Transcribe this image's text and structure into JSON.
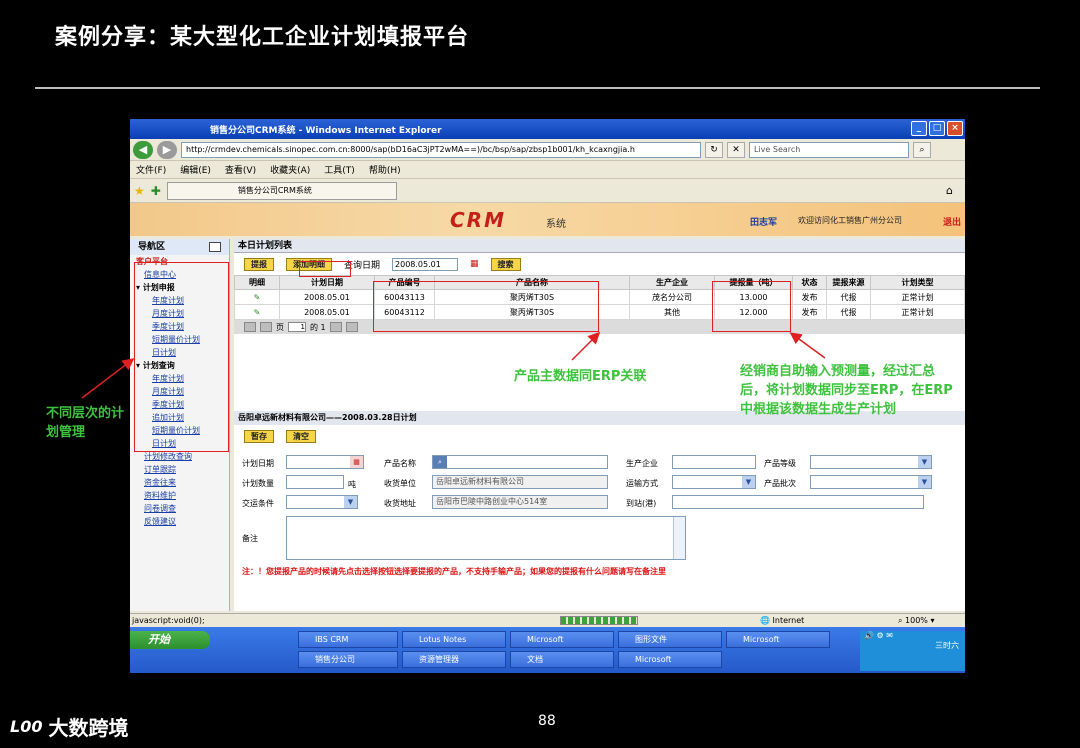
{
  "slide": {
    "title": "案例分享：某大型化工企业计划填报平台",
    "page_number": "88",
    "logo_text": "大数跨境",
    "logo_mark": "L00"
  },
  "browser": {
    "window_title": "销售分公司CRM系统 - Windows Internet Explorer",
    "address": "http://crmdev.chemicals.sinopec.com.cn:8000/sap(bD16aC3jPT2wMA==)/bc/bsp/sap/zbsp1b001/kh_kcaxngjia.h",
    "search_placeholder": "Live Search",
    "menu": [
      "文件(F)",
      "编辑(E)",
      "查看(V)",
      "收藏夹(A)",
      "工具(T)",
      "帮助(H)"
    ],
    "tab_label": "销售分公司CRM系统",
    "status_text": "javascript:void(0);",
    "zone": "Internet",
    "zoom": "100%"
  },
  "crm": {
    "logo": "CRM",
    "logo_suffix": "系统",
    "user": "田志军",
    "welcome": "欢迎访问化工销售广州分公司",
    "exit": "退出"
  },
  "sidebar": {
    "header": "导航区",
    "sections": [
      {
        "title": "客户平台",
        "items": []
      },
      {
        "title": "",
        "items": [
          "信息中心"
        ]
      },
      {
        "title": "计划申报",
        "items": [
          "年度计划",
          "月度计划",
          "季度计划",
          "短期量价计划",
          "日计划"
        ]
      },
      {
        "title": "计划查询",
        "items": [
          "年度计划",
          "月度计划",
          "季度计划",
          "追加计划",
          "短期量价计划",
          "日计划"
        ]
      }
    ],
    "tail_items": [
      "计划修改查询",
      "订单跟踪",
      "资金往来",
      "资料维护",
      "问卷调查",
      "反馈建议"
    ]
  },
  "list_panel": {
    "header": "本日计划列表",
    "submit_label": "提报",
    "add_label": "添加明细",
    "query_date_label": "查询日期",
    "query_date_value": "2008.05.01",
    "search_label": "搜索",
    "columns": [
      "明细",
      "计划日期",
      "产品编号",
      "产品名称",
      "生产企业",
      "提报量（吨）",
      "状态",
      "提报来源",
      "计划类型"
    ],
    "rows": [
      [
        "",
        "2008.05.01",
        "60043113",
        "聚丙烯T30S",
        "茂名分公司",
        "13.000",
        "发布",
        "代报",
        "正常计划"
      ],
      [
        "",
        "2008.05.01",
        "60043112",
        "聚丙烯T30S",
        "其他",
        "12.000",
        "发布",
        "代报",
        "正常计划"
      ]
    ],
    "pager_page_label": "页",
    "pager_page": "1",
    "pager_total": "的 1"
  },
  "form_panel": {
    "header": "岳阳卓远新材料有限公司——2008.03.28日计划",
    "save_label": "暂存",
    "clear_label": "清空",
    "plan_date_label": "计划日期",
    "product_name_label": "产品名称",
    "producer_label": "生产企业",
    "grade_label": "产品等级",
    "quantity_label": "计划数量",
    "unit": "吨",
    "receiver_label": "收货单位",
    "receiver_value": "岳阳卓远新材料有限公司",
    "transport_label": "运输方式",
    "batch_label": "产品批次",
    "delivery_label": "交运条件",
    "address_label": "收货地址",
    "address_value": "岳阳市巴陵中路创业中心514室",
    "station_label": "到站(港)",
    "remark_label": "备注",
    "notice": "注：！您提报产品的时候请先点击选择按钮选择要提报的产品，不支持手输产品；如果您的提报有什么问题请写在备注里"
  },
  "taskbar": {
    "start": "开始",
    "items": [
      "IBS CRM",
      "Lotus Notes",
      "Microsoft",
      "图形文件",
      "Microsoft",
      "销售分公司",
      "资源管理器",
      "文档",
      "Microsoft",
      ""
    ],
    "time": "三时六"
  },
  "annotations": {
    "left_note": "不同层次的计划管理",
    "erp_note": "产品主数据同ERP关联",
    "forecast_note": "经销商自助输入预测量，经过汇总后，将计划数据同步至ERP，在ERP中根据该数据生成生产计划"
  }
}
